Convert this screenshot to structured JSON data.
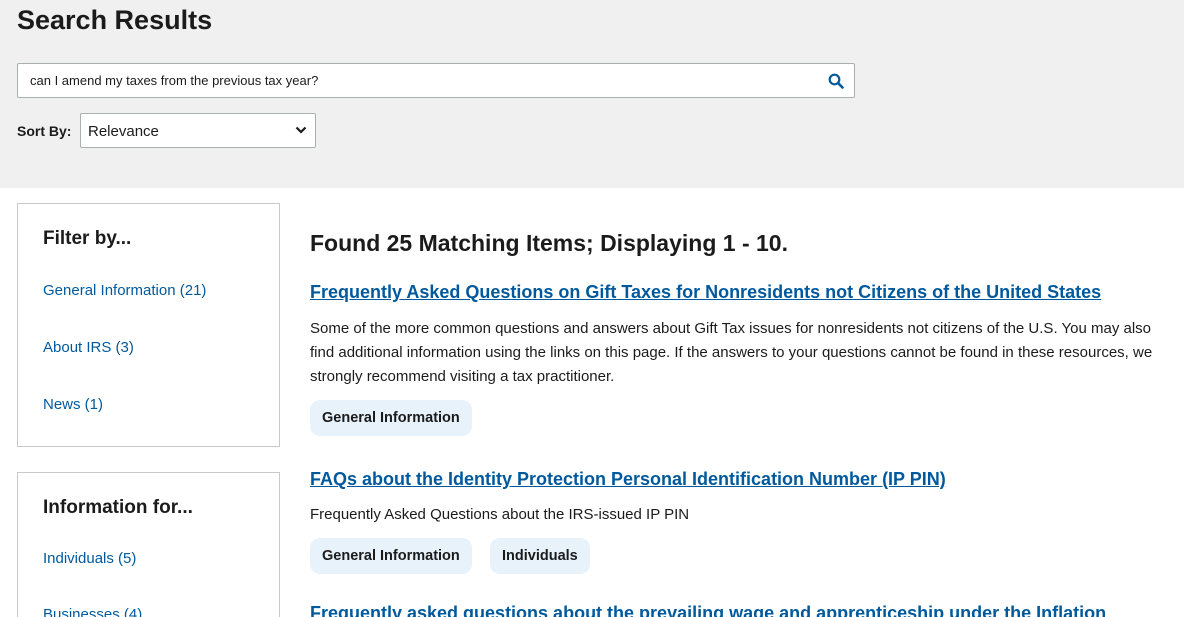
{
  "page": {
    "title": "Search Results"
  },
  "search": {
    "query": "can I amend my taxes from the previous tax year?",
    "button_icon": "search-icon"
  },
  "sort": {
    "label": "Sort By:",
    "selected": "Relevance"
  },
  "filters": {
    "filter_by": {
      "heading": "Filter by...",
      "items": [
        "General Information (21)",
        "About IRS (3)",
        "News (1)"
      ]
    },
    "information_for": {
      "heading": "Information for...",
      "items": [
        "Individuals (5)",
        "Businesses (4)"
      ]
    }
  },
  "results": {
    "heading": "Found 25 Matching Items; Displaying 1 - 10.",
    "items": [
      {
        "title": "Frequently Asked Questions on Gift Taxes for Nonresidents not Citizens of the United States",
        "description": "Some of the more common questions and answers about Gift Tax issues for nonresidents not citizens of the U.S. You may also find additional information using the links on this page. If the answers to your questions cannot be found in these resources, we strongly recommend visiting a tax practitioner.",
        "tags": [
          "General Information"
        ]
      },
      {
        "title": "FAQs about the Identity Protection Personal Identification Number (IP PIN)",
        "description": "Frequently Asked Questions about the IRS-issued IP PIN",
        "tags": [
          "General Information",
          "Individuals"
        ]
      },
      {
        "title": "Frequently asked questions about the prevailing wage and apprenticeship under the Inflation"
      }
    ]
  },
  "colors": {
    "link": "#00599c",
    "tag_bg": "#e7f2fb",
    "header_bg": "#f0f0f0"
  }
}
